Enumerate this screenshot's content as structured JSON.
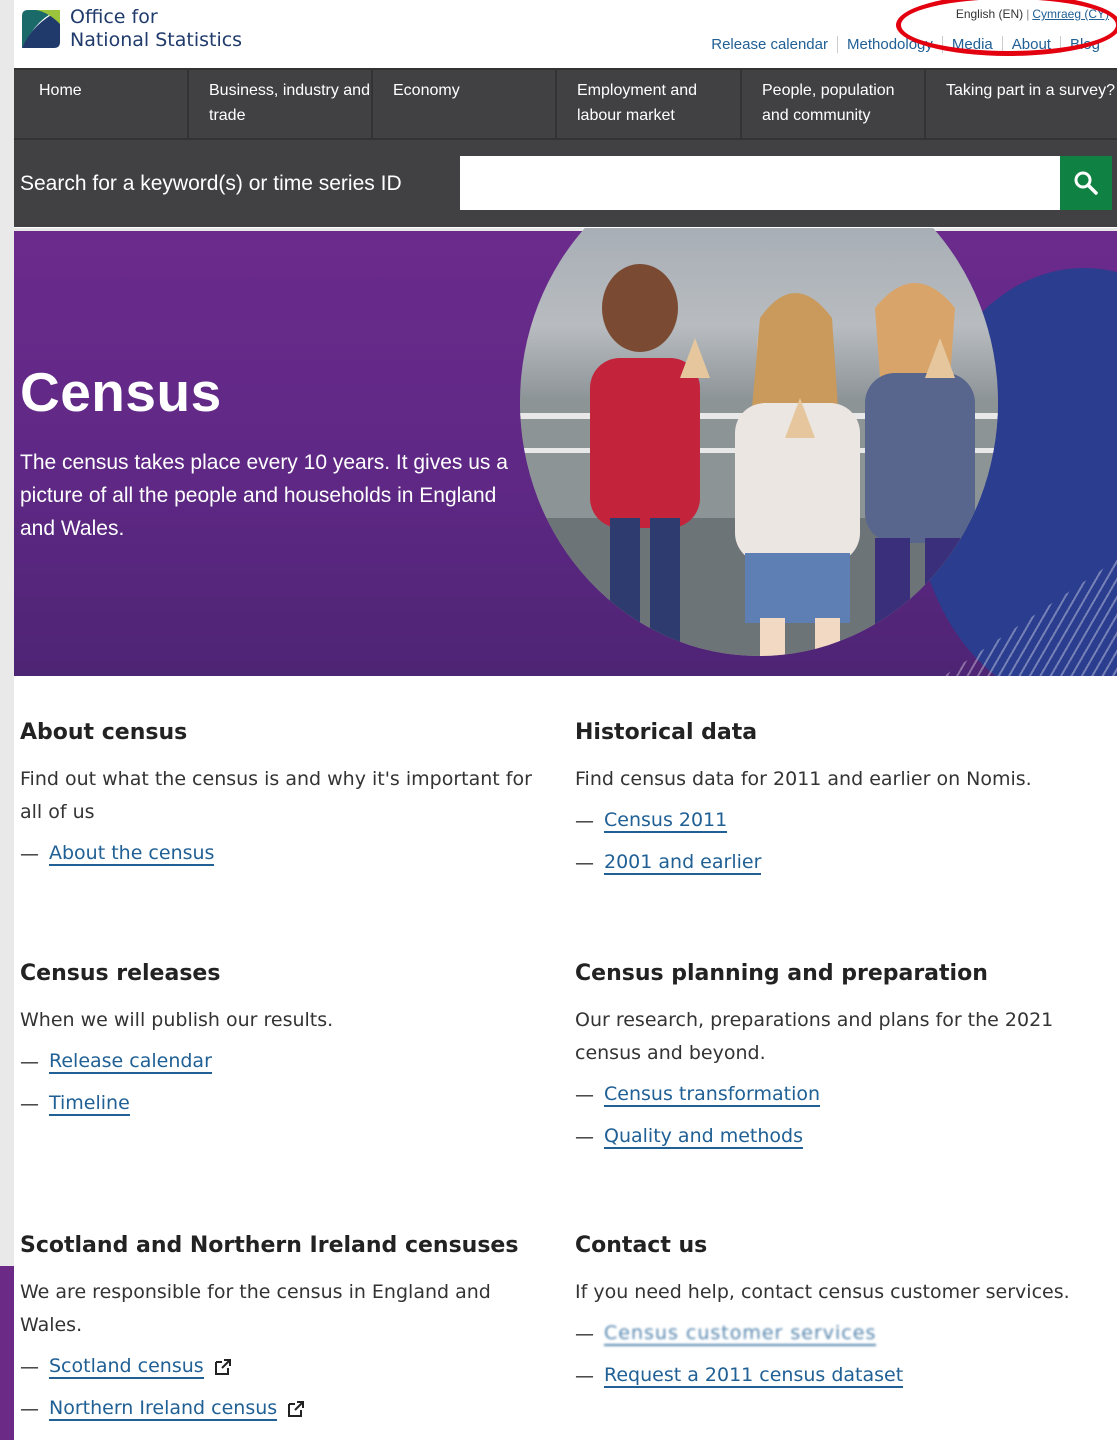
{
  "header": {
    "logo_line1": "Office for",
    "logo_line2": "National Statistics",
    "lang_current": "English (EN)",
    "lang_other": "Cymraeg (CY)",
    "lang_separator": "|",
    "top_links": [
      "Release calendar",
      "Methodology",
      "Media",
      "About",
      "Blog"
    ]
  },
  "nav": {
    "items": [
      "Home",
      "Business, industry and trade",
      "Economy",
      "Employment and labour market",
      "People, population and community",
      "Taking part in a survey?"
    ]
  },
  "search": {
    "label": "Search for a keyword(s) or time series ID",
    "value": "",
    "button_icon": "search-icon"
  },
  "hero": {
    "title": "Census",
    "description": "The census takes place every 10 years. It gives us a picture of all the people and households in England and Wales."
  },
  "sections": {
    "about": {
      "title": "About census",
      "text": "Find out what the census is and why it's important for all of us",
      "links": [
        "About the census"
      ]
    },
    "historical": {
      "title": "Historical data",
      "text": "Find census data for 2011 and earlier on Nomis.",
      "links": [
        "Census 2011",
        "2001 and earlier"
      ]
    },
    "releases": {
      "title": "Census releases",
      "text": "When we will publish our results.",
      "links": [
        "Release calendar",
        "Timeline"
      ]
    },
    "planning": {
      "title": "Census planning and preparation",
      "text": "Our research, preparations and plans for the 2021 census and beyond.",
      "links": [
        "Census transformation",
        "Quality and methods"
      ]
    },
    "scotland_ni": {
      "title": "Scotland and Northern Ireland censuses",
      "text": "We are responsible for the census in England and Wales.",
      "links": [
        "Scotland census",
        "Northern Ireland census"
      ]
    },
    "contact": {
      "title": "Contact us",
      "text": "If you need help, contact census customer services.",
      "links": [
        "Census customer services",
        "Request a 2011 census dataset"
      ]
    }
  },
  "colors": {
    "nav_bg": "#414042",
    "search_button": "#0f8243",
    "hero_purple": "#6b2b8c",
    "link_blue": "#206095",
    "annotation_ring": "#e3000f"
  }
}
